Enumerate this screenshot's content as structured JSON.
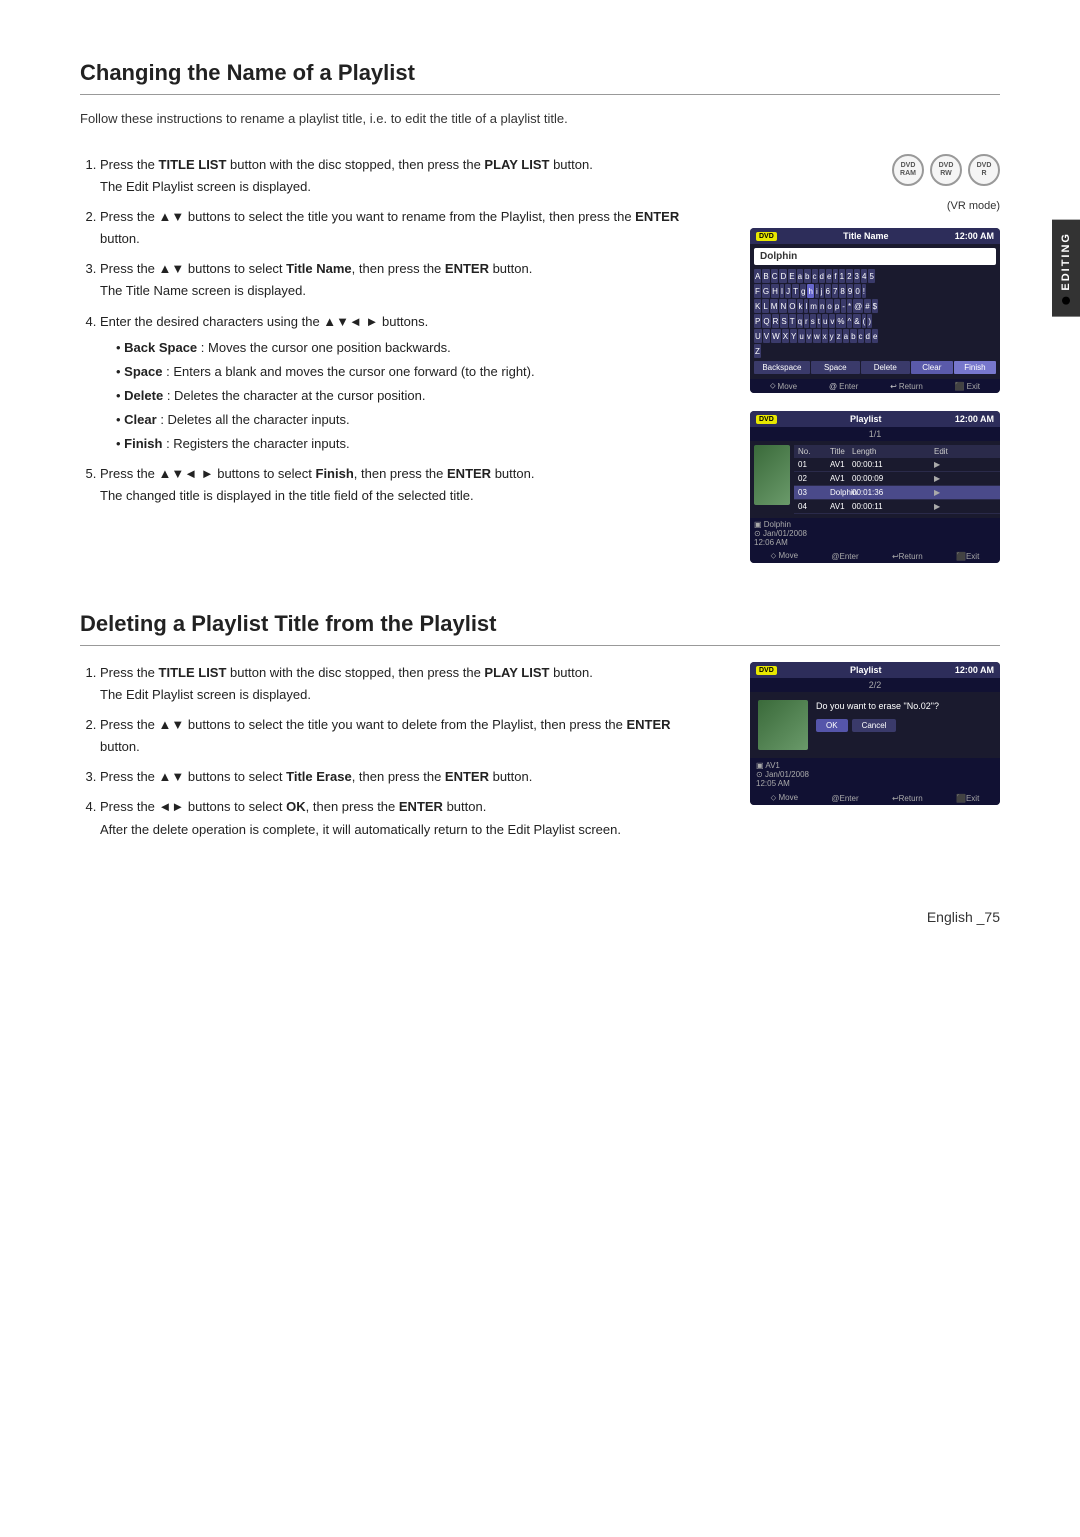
{
  "page": {
    "number": "English _75"
  },
  "editing_tab": {
    "label": "EDITING"
  },
  "section1": {
    "title": "Changing the Name of a Playlist",
    "intro": "Follow these instructions to rename a playlist title, i.e. to edit the title of a playlist title.",
    "vr_mode": "(VR mode)",
    "dvd_icons": [
      {
        "label": "DVD-RAM"
      },
      {
        "label": "DVD-RW"
      },
      {
        "label": "DVD-R"
      }
    ],
    "steps": [
      {
        "id": 1,
        "text_before": "Press the ",
        "bold1": "TITLE LIST",
        "text_mid1": " button with the disc stopped, then press the ",
        "bold2": "PLAY LIST",
        "text_mid2": " button.",
        "note": "The Edit Playlist screen is displayed."
      },
      {
        "id": 2,
        "text_before": "Press the ▲▼ buttons to select the title you want to rename from the Playlist, then press the ",
        "bold1": "ENTER",
        "text_after": " button."
      },
      {
        "id": 3,
        "text_before": "Press the ▲▼ buttons to select ",
        "bold1": "Title Name",
        "text_mid1": ", then press the ",
        "bold2": "ENTER",
        "text_after": " button.",
        "note": "The Title Name screen is displayed."
      },
      {
        "id": 4,
        "text_before": "Enter the desired characters using the ▲▼◄ ► buttons.",
        "bullets": [
          {
            "bold": "Back Space",
            "text": " : Moves the cursor one position backwards."
          },
          {
            "bold": "Space",
            "text": " : Enters a blank and moves the cursor one forward (to the right)."
          },
          {
            "bold": "Delete",
            "text": " : Deletes the character at the cursor position."
          },
          {
            "bold": "Clear",
            "text": " : Deletes all the character inputs."
          },
          {
            "bold": "Finish",
            "text": " : Registers the character inputs."
          }
        ]
      },
      {
        "id": 5,
        "text_before": "Press the ▲▼◄ ► buttons to select ",
        "bold1": "Finish",
        "text_mid1": ", then press the ",
        "bold2": "ENTER",
        "text_after": " button.",
        "note": "The changed title is displayed in the title field of the selected title."
      }
    ]
  },
  "section2": {
    "title": "Deleting a Playlist Title from the Playlist",
    "steps": [
      {
        "id": 1,
        "text_before": "Press the ",
        "bold1": "TITLE LIST",
        "text_mid1": " button with the disc stopped, then press the ",
        "bold2": "PLAY LIST",
        "text_mid2": " button.",
        "note": "The Edit Playlist screen is displayed."
      },
      {
        "id": 2,
        "text_before": "Press the ▲▼ buttons to select the title you want to delete from the Playlist, then press the ",
        "bold1": "ENTER",
        "text_after": " button."
      },
      {
        "id": 3,
        "text_before": "Press the ▲▼ buttons to select ",
        "bold1": "Title Erase",
        "text_mid1": ", then press the ",
        "bold2": "ENTER",
        "text_after": " button."
      },
      {
        "id": 4,
        "text_before": "Press the ◄► buttons to select ",
        "bold1": "OK",
        "text_mid1": ", then press the ",
        "bold2": "ENTER",
        "text_after": " button.",
        "note": "After the delete operation is complete, it will automatically return to the Edit Playlist screen."
      }
    ]
  },
  "screen1": {
    "header_icon": "DVD",
    "title": "Title Name",
    "time": "12:00 AM",
    "input_value": "Dolphin",
    "keyboard_rows": [
      [
        "A",
        "B",
        "C",
        "D",
        "E",
        "a",
        "b",
        "c",
        "d",
        "e",
        "f",
        "1",
        "2",
        "3",
        "4",
        "5"
      ],
      [
        "F",
        "G",
        "H",
        "I",
        "J",
        "T",
        "6",
        "h",
        "i",
        "j",
        "6",
        "7",
        "8",
        "9",
        "0"
      ],
      [
        "K",
        "L",
        "M",
        "N",
        "O",
        "k",
        "l",
        "m",
        "n",
        "o",
        "p",
        "-",
        "*",
        "!",
        "@",
        "#"
      ],
      [
        "P",
        "Q",
        "R",
        "S",
        "T",
        "q",
        "r",
        "s",
        "t",
        "u",
        "v",
        "$",
        "%",
        "^",
        "&",
        "("
      ],
      [
        "U",
        "V",
        "W",
        "X",
        "Y",
        "u",
        "v",
        "w",
        "x",
        "y",
        "z",
        "a",
        "b",
        "c",
        "d",
        "e"
      ],
      [
        "Z"
      ]
    ],
    "action_buttons": [
      "Backspace",
      "Space",
      "Delete",
      "Clear",
      "Finish"
    ],
    "nav": [
      "Move",
      "Enter",
      "Return",
      "Exit"
    ]
  },
  "screen2": {
    "header_icon": "DVD",
    "title": "Playlist",
    "time": "12:00 AM",
    "page_indicator": "1/1",
    "columns": [
      "No.",
      "Title",
      "Length",
      "Edit"
    ],
    "rows": [
      {
        "no": "01",
        "title": "AV1",
        "length": "00:00:11",
        "edit": "▶"
      },
      {
        "no": "02",
        "title": "AV1",
        "length": "00:00:09",
        "edit": "▶"
      },
      {
        "no": "03",
        "title": "Dolphin",
        "length": "00:01:36",
        "edit": "▶"
      },
      {
        "no": "04",
        "title": "AV1",
        "length": "00:00:11",
        "edit": "▶"
      }
    ],
    "selected_info": "Dolphin",
    "date": "Jan/01/2008",
    "time2": "12:06 AM",
    "nav": [
      "Move",
      "Enter",
      "Return",
      "Exit"
    ]
  },
  "screen3": {
    "header_icon": "DVD",
    "title": "Playlist",
    "time": "12:00 AM",
    "page_indicator": "2/2",
    "dialog_text": "Do you want to erase \"No.02\"?",
    "info_title": "AV1",
    "info_date": "Jan/01/2008",
    "info_time": "12:05 AM",
    "ok_label": "OK",
    "cancel_label": "Cancel",
    "nav": [
      "Move",
      "Enter",
      "Return",
      "Exit"
    ]
  }
}
